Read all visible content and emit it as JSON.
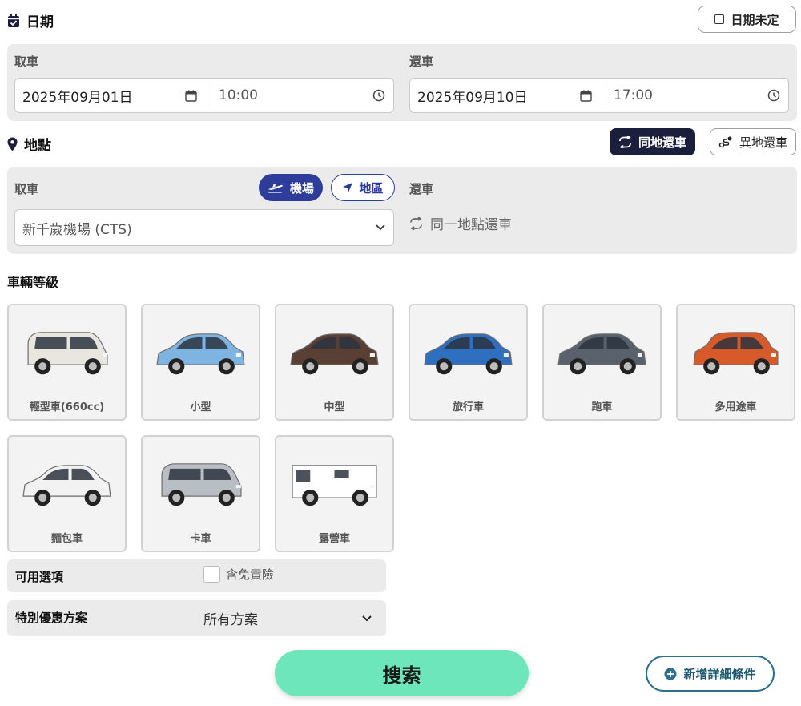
{
  "date_section": {
    "title": "日期",
    "icon": "calendar-check-icon",
    "undecided_label": "日期未定",
    "pickup_label": "取車",
    "return_label": "還車",
    "pickup_date": "2025年09月01日",
    "pickup_time": "10:00",
    "return_date": "2025年09月10日",
    "return_time": "17:00"
  },
  "location_section": {
    "title": "地點",
    "icon": "map-pin-icon",
    "same_return_label": "同地還車",
    "different_return_label": "異地還車",
    "pickup_label": "取車",
    "airport_label": "機場",
    "area_label": "地區",
    "pickup_location": "新千歲機場 (CTS)",
    "return_label": "還車",
    "return_location": "同一地點還車"
  },
  "vehicle_section": {
    "title": "車輛等級",
    "classes": [
      {
        "label": "輕型車(660cc)",
        "color": "#e9e5df"
      },
      {
        "label": "小型",
        "color": "#7fb3e0"
      },
      {
        "label": "中型",
        "color": "#5a4034"
      },
      {
        "label": "旅行車",
        "color": "#2e6fbf"
      },
      {
        "label": "跑車",
        "color": "#59616d"
      },
      {
        "label": "多用途車",
        "color": "#d8592a"
      },
      {
        "label": "麵包車",
        "color": "#f2f2f2"
      },
      {
        "label": "卡車",
        "color": "#b9bec4"
      },
      {
        "label": "露營車",
        "color": "#ffffff"
      }
    ]
  },
  "options": {
    "available_label": "可用選項",
    "insurance_label": "含免責險",
    "insurance_checked": false,
    "special_label": "特別優惠方案",
    "special_value": "所有方案"
  },
  "actions": {
    "search_label": "搜索",
    "more_label": "新增詳細條件"
  },
  "colors": {
    "accent_blue": "#2e3d99",
    "dark_navy": "#1b1f3b",
    "search_green": "#6ce6ba",
    "more_teal": "#2b6f8a"
  }
}
